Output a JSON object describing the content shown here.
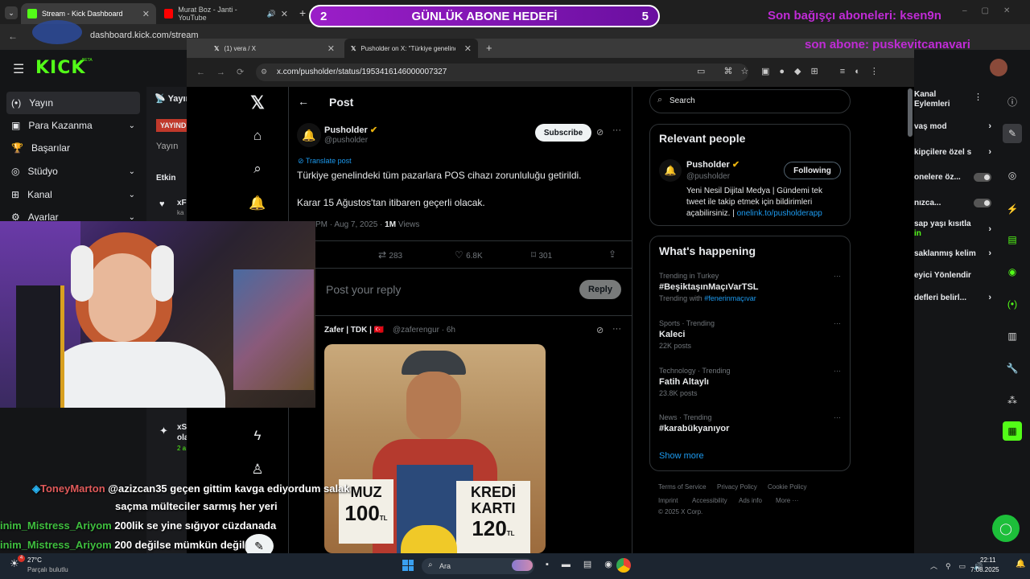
{
  "outer_tabs": [
    {
      "label": "Stream - Kick Dashboard"
    },
    {
      "label": "Murat Boz - Janti - YouTube"
    }
  ],
  "outer_url": "dashboard.kick.com/stream",
  "kick": {
    "logo": "KICK",
    "logo_badge": "BETA",
    "sidebar": [
      {
        "label": "Yayın",
        "icon": "(•)"
      },
      {
        "label": "Para Kazanma",
        "icon": "▣"
      },
      {
        "label": "Başarılar",
        "icon": "🏆"
      },
      {
        "label": "Stüdyo",
        "icon": "◎"
      },
      {
        "label": "Kanal",
        "icon": "⊞"
      },
      {
        "label": "Ayarlar",
        "icon": "⚙"
      }
    ],
    "col2": {
      "header": "Yayın",
      "badge": "YAYIND",
      "sub": "Yayın",
      "activity": "Etkin",
      "item1": "xF",
      "item1b": "ka",
      "item2": "xS",
      "item2b": "ola",
      "item2c": "2 a"
    },
    "right_panel": {
      "title": "Kanal Eylemleri",
      "rows": [
        {
          "label": "vaş mod",
          "control": "arrow"
        },
        {
          "label": "kipçilere özel s",
          "control": "arrow"
        },
        {
          "label": "onelere öz...",
          "control": "toggle"
        },
        {
          "label": "nızca...",
          "control": "toggle"
        },
        {
          "label": "sap yaşı kısıtla",
          "sub": "in",
          "control": "arrow"
        },
        {
          "label": "saklanmış kelim",
          "control": "arrow"
        },
        {
          "label": "eyici Yönlendir",
          "control": "none"
        },
        {
          "label": "defleri belirl...",
          "control": "arrow"
        }
      ]
    }
  },
  "inner": {
    "tabs": [
      {
        "label": "(1) vera / X"
      },
      {
        "label": "Pusholder on X: \"Türkiye genelind"
      }
    ],
    "url": "x.com/pusholder/status/1953416146000007327"
  },
  "post": {
    "header": "Post",
    "author_name": "Pusholder",
    "author_handle": "@pusholder",
    "subscribe_label": "Subscribe",
    "translate_label": "Translate post",
    "text1": "Türkiye genelindeki tüm pazarlara POS cihazı zorunluluğu getirildi.",
    "text2": "Karar 15 Ağustos'tan itibaren geçerli olacak.",
    "timestamp": "PM · Aug 7, 2025 · ",
    "views_count": "1M",
    "views_label": " Views",
    "retweets": "283",
    "likes": "6.8K",
    "bookmarks": "301",
    "reply_placeholder": "Post your reply",
    "reply_button": "Reply"
  },
  "reply": {
    "name": "Zafer | TDK |",
    "handle": "@zaferengur · 6h",
    "sign1_line1": "MUZ",
    "sign1_line2": "100",
    "sign1_unit": "TL",
    "sign2_line1": "KREDİ",
    "sign2_line2": "KARTI",
    "sign2_line3": "120",
    "sign2_unit": "TL"
  },
  "sidebar_right": {
    "search_placeholder": "Search",
    "relevant_title": "Relevant people",
    "person_name": "Pusholder",
    "person_handle": "@pusholder",
    "following_label": "Following",
    "bio": "Yeni Nesil Dijital Medya | Gündemi tek tweet ile takip etmek için bildirimleri açabilirsiniz. |",
    "bio_link": "onelink.to/pusholderapp",
    "happening_title": "What's happening",
    "trends": [
      {
        "meta": "Trending in Turkey",
        "title": "#BeşiktaşınMaçıVarTSL",
        "sub": "Trending with ",
        "sub_link": "#fenerinmaçıvar"
      },
      {
        "meta": "Sports · Trending",
        "title": "Kaleci",
        "sub": "22K posts"
      },
      {
        "meta": "Technology · Trending",
        "title": "Fatih Altaylı",
        "sub": "23.8K posts"
      },
      {
        "meta": "News · Trending",
        "title": "#karabükyanıyor",
        "sub": ""
      }
    ],
    "show_more": "Show more",
    "footer": [
      "Terms of Service",
      "Privacy Policy",
      "Cookie Policy",
      "Imprint",
      "Accessibility",
      "Ads info",
      "More ···",
      "© 2025 X Corp."
    ]
  },
  "overlay": {
    "goal_left": "2",
    "goal_text": "GÜNLÜK ABONE HEDEFİ",
    "goal_right": "5",
    "last_donor": "Son bağışçı aboneleri: ksen9n",
    "last_sub": "son abone: puskevitcanavari",
    "chat": [
      {
        "user": "ToneyMarton",
        "user_color": "#e05a5a",
        "msg": "@azizcan35 geçen gittim kavga ediyordum salak"
      },
      {
        "user": "",
        "msg": "saçma mülteciler sarmış her yeri"
      },
      {
        "user": "inim_Mistress_Ariyom",
        "user_color": "#3fbf3f",
        "msg": "200lik se yine sığıyor cüzdanada"
      },
      {
        "user": "inim_Mistress_Ariyom",
        "user_color": "#3fbf3f",
        "msg": "200 değilse mümkün değil"
      }
    ]
  },
  "taskbar": {
    "weather_temp": "27°C",
    "weather_desc": "Parçalı bulutlu",
    "weather_badge": "4",
    "search_label": "Ara",
    "time": "22:11",
    "date": "7.08.2025"
  },
  "colors": {
    "kick_green": "#53fc18",
    "x_blue": "#1d9bf0",
    "overlay_pink": "#c02bd6"
  }
}
